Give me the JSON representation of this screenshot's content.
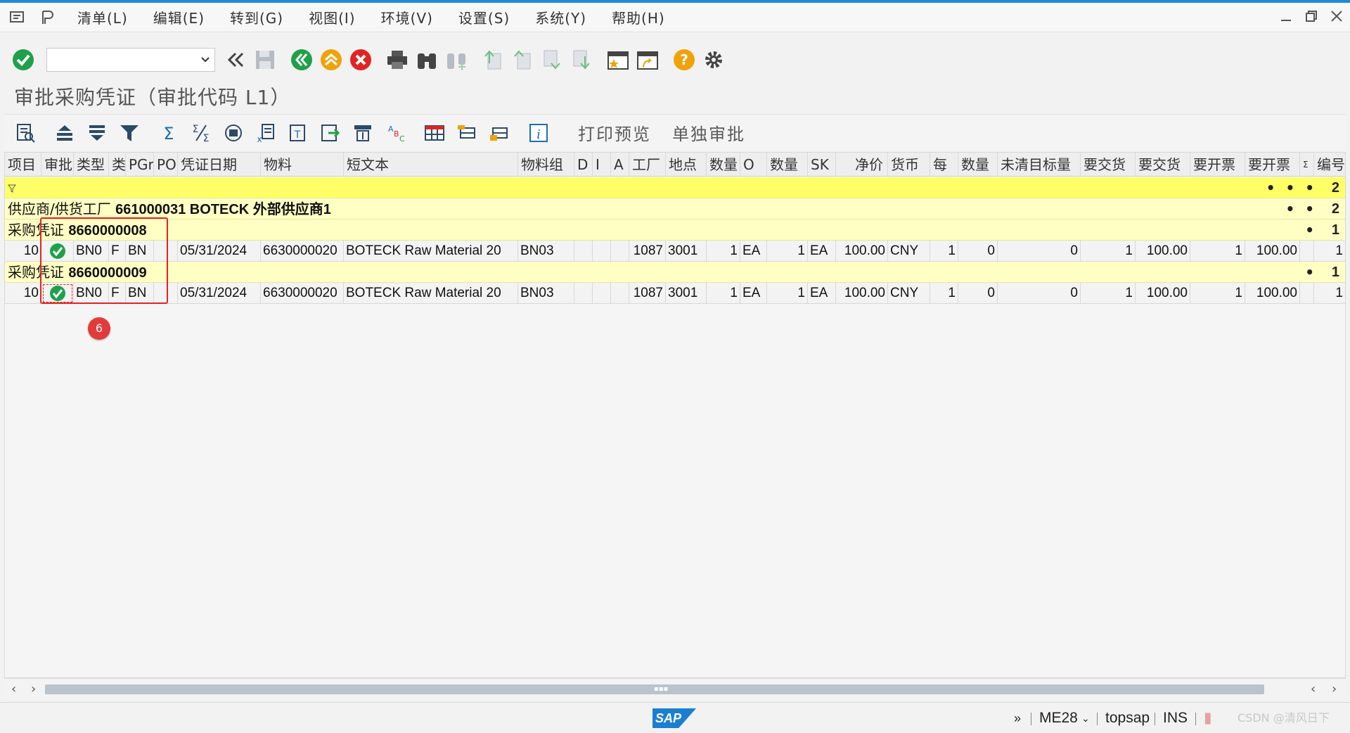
{
  "colors": {
    "accent": "#1d8ad8",
    "filter_row": "#ffff66",
    "group_row": "#ffffc4",
    "highlight": "#e02424",
    "ok_green": "#1fa04a"
  },
  "menubar": {
    "items": [
      "清单(L)",
      "编辑(E)",
      "转到(G)",
      "视图(I)",
      "环境(V)",
      "设置(S)",
      "系统(Y)",
      "帮助(H)"
    ]
  },
  "toolbar": {
    "command_field": ""
  },
  "page": {
    "title": "审批采购凭证（审批代码 L1）"
  },
  "alv": {
    "print_preview": "打印预览",
    "single_approve": "单独审批"
  },
  "grid": {
    "headers": [
      "项目",
      "审批",
      "类型",
      "类",
      "PGr",
      "PO",
      "凭证日期",
      "物料",
      "短文本",
      "物料组",
      "D",
      "I",
      "A",
      "工厂",
      "地点",
      "数量",
      "O",
      "数量",
      "SK",
      "净价",
      "货币",
      "每",
      "数量",
      "未清目标量",
      "要交货",
      "要交货",
      "要开票",
      "要开票",
      "Σ",
      "编号"
    ],
    "filter_row": {
      "dots": "• • •",
      "count": "2"
    },
    "vendor_group": {
      "label": "供应商/供货工厂",
      "vendor": "661000031  BOTECK 外部供应商1",
      "dots": "• •",
      "count": "2"
    },
    "po_groups": [
      {
        "label": "采购凭证",
        "po": "8660000008",
        "dots": "•",
        "count": "1",
        "row": [
          "10",
          "BN0",
          "F",
          "BN",
          "05/31/2024",
          "6630000020",
          "BOTECK Raw Material 20",
          "BN03",
          "1087",
          "3001",
          "1",
          "EA",
          "1",
          "EA",
          "100.00",
          "CNY",
          "1",
          "0",
          "0",
          "1",
          "100.00",
          "1",
          "100.00",
          "1"
        ]
      },
      {
        "label": "采购凭证",
        "po": "8660000009",
        "dots": "•",
        "count": "1",
        "row": [
          "10",
          "BN0",
          "F",
          "BN",
          "05/31/2024",
          "6630000020",
          "BOTECK Raw Material 20",
          "BN03",
          "1087",
          "3001",
          "1",
          "EA",
          "1",
          "EA",
          "100.00",
          "CNY",
          "1",
          "0",
          "0",
          "1",
          "100.00",
          "1",
          "100.00",
          "1"
        ]
      }
    ]
  },
  "annotation": {
    "badge": "6"
  },
  "statusbar": {
    "transaction": "ME28",
    "system": "topsap",
    "mode": "INS",
    "watermark": "CSDN @清风日下",
    "logo": "SAP"
  }
}
